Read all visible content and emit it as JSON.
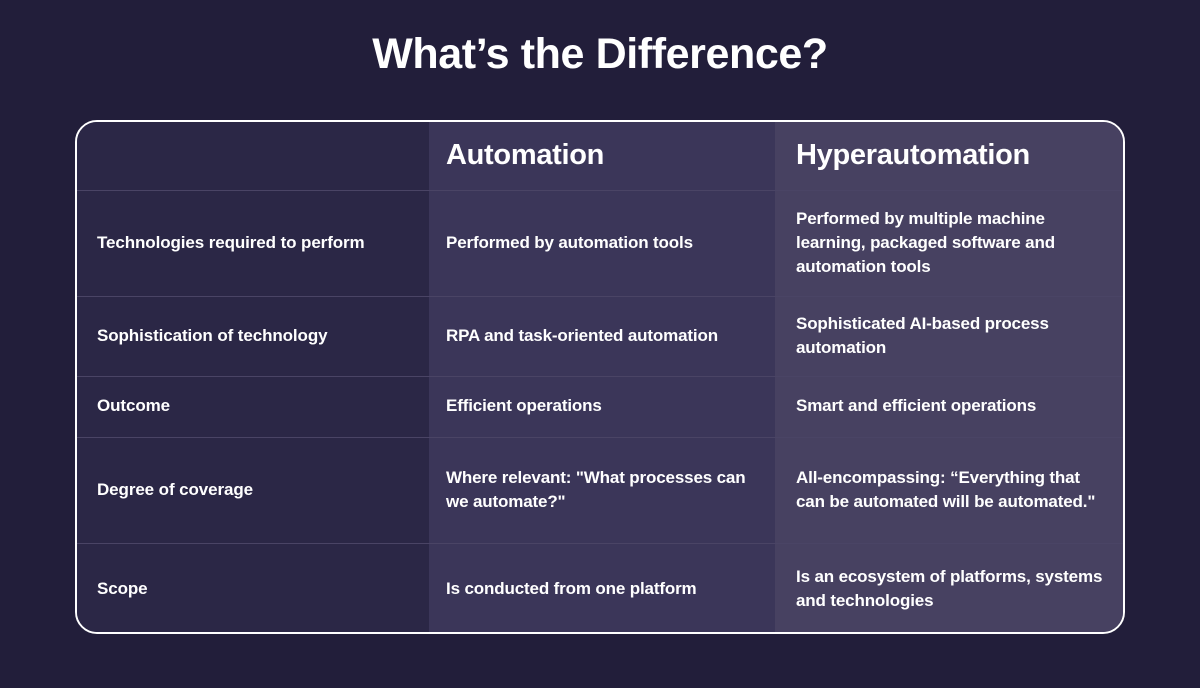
{
  "page": {
    "title": "What’s the Difference?",
    "background_color": "#221e3a"
  },
  "colors": {
    "page_background": "#221e3a",
    "column_1_background": "#2b2746",
    "column_2_background": "#3b3659",
    "column_3_background": "#474161",
    "border": "#ffffff",
    "row_divider": "#4a4465",
    "text": "#ffffff"
  },
  "table": {
    "headers": {
      "attribute": "",
      "column_2": "Automation",
      "column_3": "Hyperautomation"
    },
    "rows": [
      {
        "label": "Technologies required to perform",
        "automation": "Performed by automation tools",
        "hyperautomation": "Performed by multiple machine learning, packaged software and automation tools"
      },
      {
        "label": "Sophistication of technology",
        "automation": "RPA and task-oriented automation",
        "hyperautomation": "Sophisticated AI-based process automation"
      },
      {
        "label": "Outcome",
        "automation": "Efficient operations",
        "hyperautomation": "Smart and efficient operations"
      },
      {
        "label": "Degree of coverage",
        "automation": "Where relevant: \"What processes can we automate?\"",
        "hyperautomation": "All-encompassing: “Everything that can be automated will be automated.\""
      },
      {
        "label": "Scope",
        "automation": "Is conducted from one platform",
        "hyperautomation": "Is an ecosystem of platforms, systems and technologies"
      }
    ]
  }
}
